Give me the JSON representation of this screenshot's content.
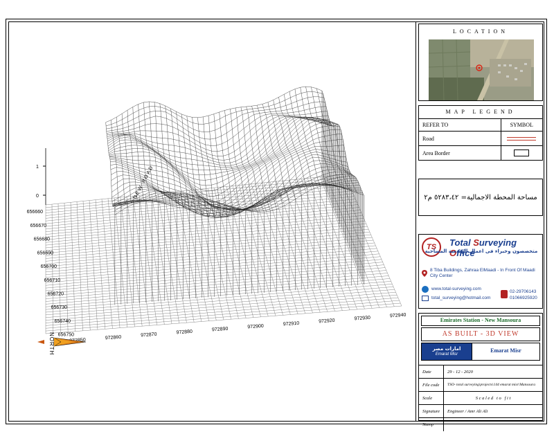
{
  "location": {
    "title": "LOCATION"
  },
  "legend": {
    "title": "MAP LEGEND",
    "col_refer": "REFER TO",
    "col_symbol": "SYMBOL",
    "items": [
      {
        "label": "Road",
        "symbol": "road-line"
      },
      {
        "label": "Area Border",
        "symbol": "border-box"
      }
    ]
  },
  "area_text": "مساحة المحطة الاجمالية= ٥٢٨٣،٤٢ م٢",
  "office": {
    "name_part1": "Total ",
    "name_s": "S",
    "name_part2": "urveying ",
    "name_o": "O",
    "name_part3": "ffice",
    "tagline_ar": "متخصصون وخبراء فى اعمال الهندسة المساحية",
    "logo_text": "TS",
    "address": "8 Tiba Buildings, Zahraa ElMaadi - In Front Of Maadi City Center",
    "website": "www.total-surveying.com",
    "email": "total_surveying@hotmail.com",
    "phone1": "02-29706143",
    "phone2": "01066925920"
  },
  "project": {
    "name": "Emirates Station  -  New Mansoura",
    "view_title": "AS BUILT  -  3D VIEW",
    "client_logo_ar": "امارات مصر",
    "client_logo_en": "Emarat Misr",
    "client_name": "Emarat Misr"
  },
  "info": [
    {
      "label": "Date",
      "value": "29 - 12 - 2020"
    },
    {
      "label": "File code",
      "value": "TSO- total surveying\\projects\\144 emarat misr\\Mansoura"
    },
    {
      "label": "Scale",
      "value": "S c a l e d   t o   f i t"
    },
    {
      "label": "Signature",
      "value": "Engineer / Amr Ali Ali"
    },
    {
      "label": "Stamp",
      "value": ""
    }
  ],
  "plot": {
    "road_label": "NEW ROAD",
    "north_label": "NORTH",
    "z_ticks": [
      "1",
      "0"
    ],
    "y_ticks": [
      "656660",
      "656670",
      "656680",
      "656690",
      "656700",
      "656710",
      "656720",
      "656730",
      "656740",
      "656750"
    ],
    "x_ticks": [
      "972850",
      "972860",
      "972870",
      "972880",
      "972890",
      "972900",
      "972910",
      "972920",
      "972930",
      "972940"
    ]
  },
  "colors": {
    "map_bg": "#8a8f7a",
    "office_blue": "#1a3f8f",
    "office_red": "#b22222",
    "accent_red": "#c0392b"
  }
}
